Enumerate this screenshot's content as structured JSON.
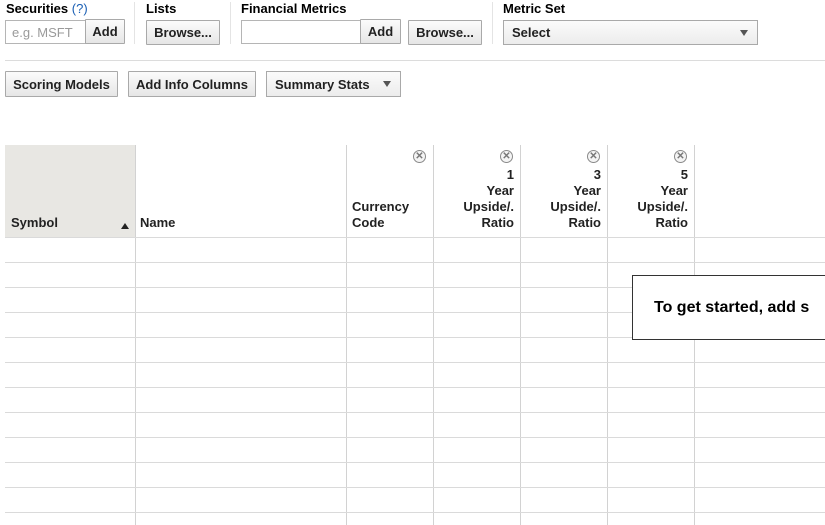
{
  "toolbar": {
    "securities": {
      "label": "Securities",
      "help": "(?)",
      "placeholder": "e.g. MSFT",
      "add_label": "Add"
    },
    "lists": {
      "label": "Lists",
      "browse_label": "Browse..."
    },
    "financial_metrics": {
      "label": "Financial Metrics",
      "add_label": "Add",
      "browse_label": "Browse..."
    },
    "metric_set": {
      "label": "Metric Set",
      "selected": "Select"
    }
  },
  "actions": {
    "scoring_models": "Scoring Models",
    "add_info_columns": "Add Info Columns",
    "summary_stats": "Summary Stats"
  },
  "grid": {
    "columns": {
      "symbol": "Symbol",
      "name": "Name",
      "currency_line1": "Currency",
      "currency_line2": "Code",
      "up1_line1": "1",
      "up1_line2": "Year",
      "up1_line3": "Upside/.",
      "up1_line4": "Ratio",
      "up3_line1": "3",
      "up3_line2": "Year",
      "up3_line3": "Upside/.",
      "up3_line4": "Ratio",
      "up5_line1": "5",
      "up5_line2": "Year",
      "up5_line3": "Upside/.",
      "up5_line4": "Ratio"
    },
    "sort_column": "Symbol",
    "empty_message": "To get started, add s"
  },
  "colors": {
    "link": "#1a5fb4",
    "header_bg": "#e8e7e3"
  }
}
